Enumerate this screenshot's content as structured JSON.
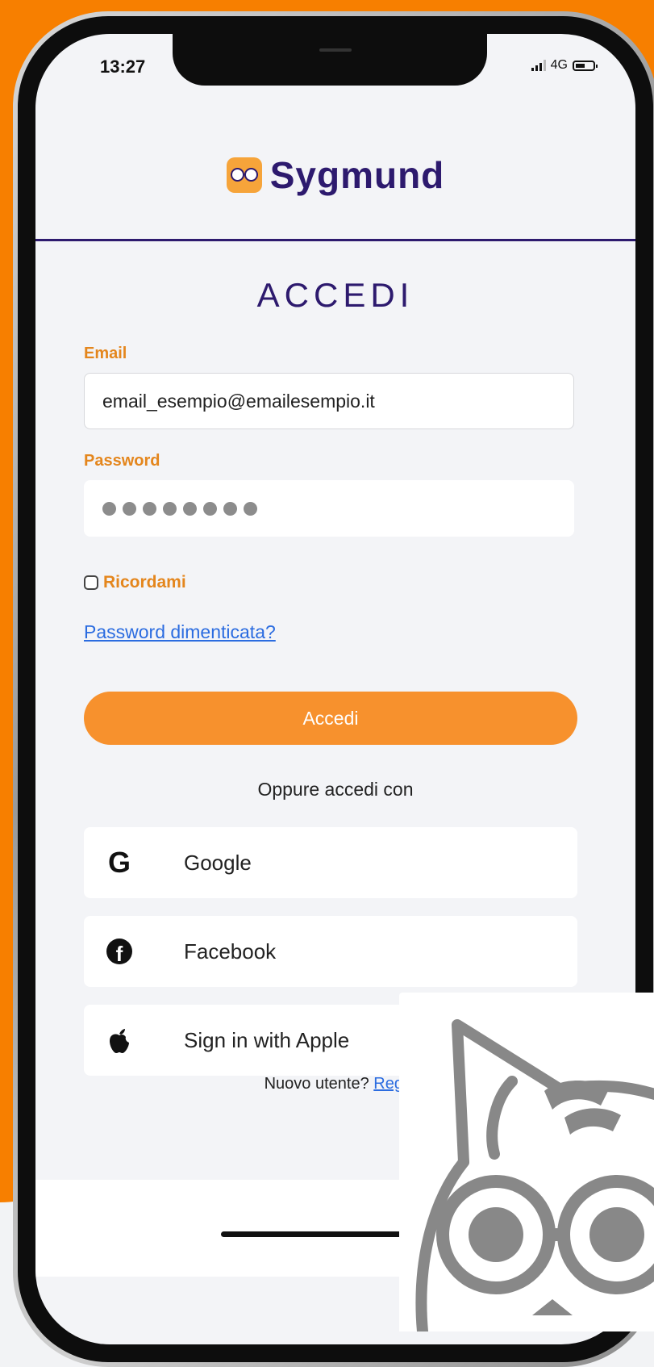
{
  "status_bar": {
    "time": "13:27",
    "network": "4G"
  },
  "header": {
    "brand": "Sygmund"
  },
  "page": {
    "title": "ACCEDI"
  },
  "form": {
    "email_label": "Email",
    "email_value": "email_esempio@emailesempio.it",
    "password_label": "Password",
    "password_mask_length": 8,
    "remember_label": "Ricordami",
    "forgot_link": "Password dimenticata?",
    "submit_label": "Accedi"
  },
  "social": {
    "intro": "Oppure accedi con",
    "providers": [
      {
        "label": "Google",
        "icon": "google-icon"
      },
      {
        "label": "Facebook",
        "icon": "facebook-icon"
      },
      {
        "label": "Sign in with Apple",
        "icon": "apple-icon"
      }
    ]
  },
  "footer": {
    "prompt": "Nuovo utente?",
    "link": "Regi"
  },
  "colors": {
    "orange": "#f77f00",
    "brand_purple": "#2d1a6e",
    "accent_orange": "#e4861d",
    "link_blue": "#2b6ce0"
  }
}
